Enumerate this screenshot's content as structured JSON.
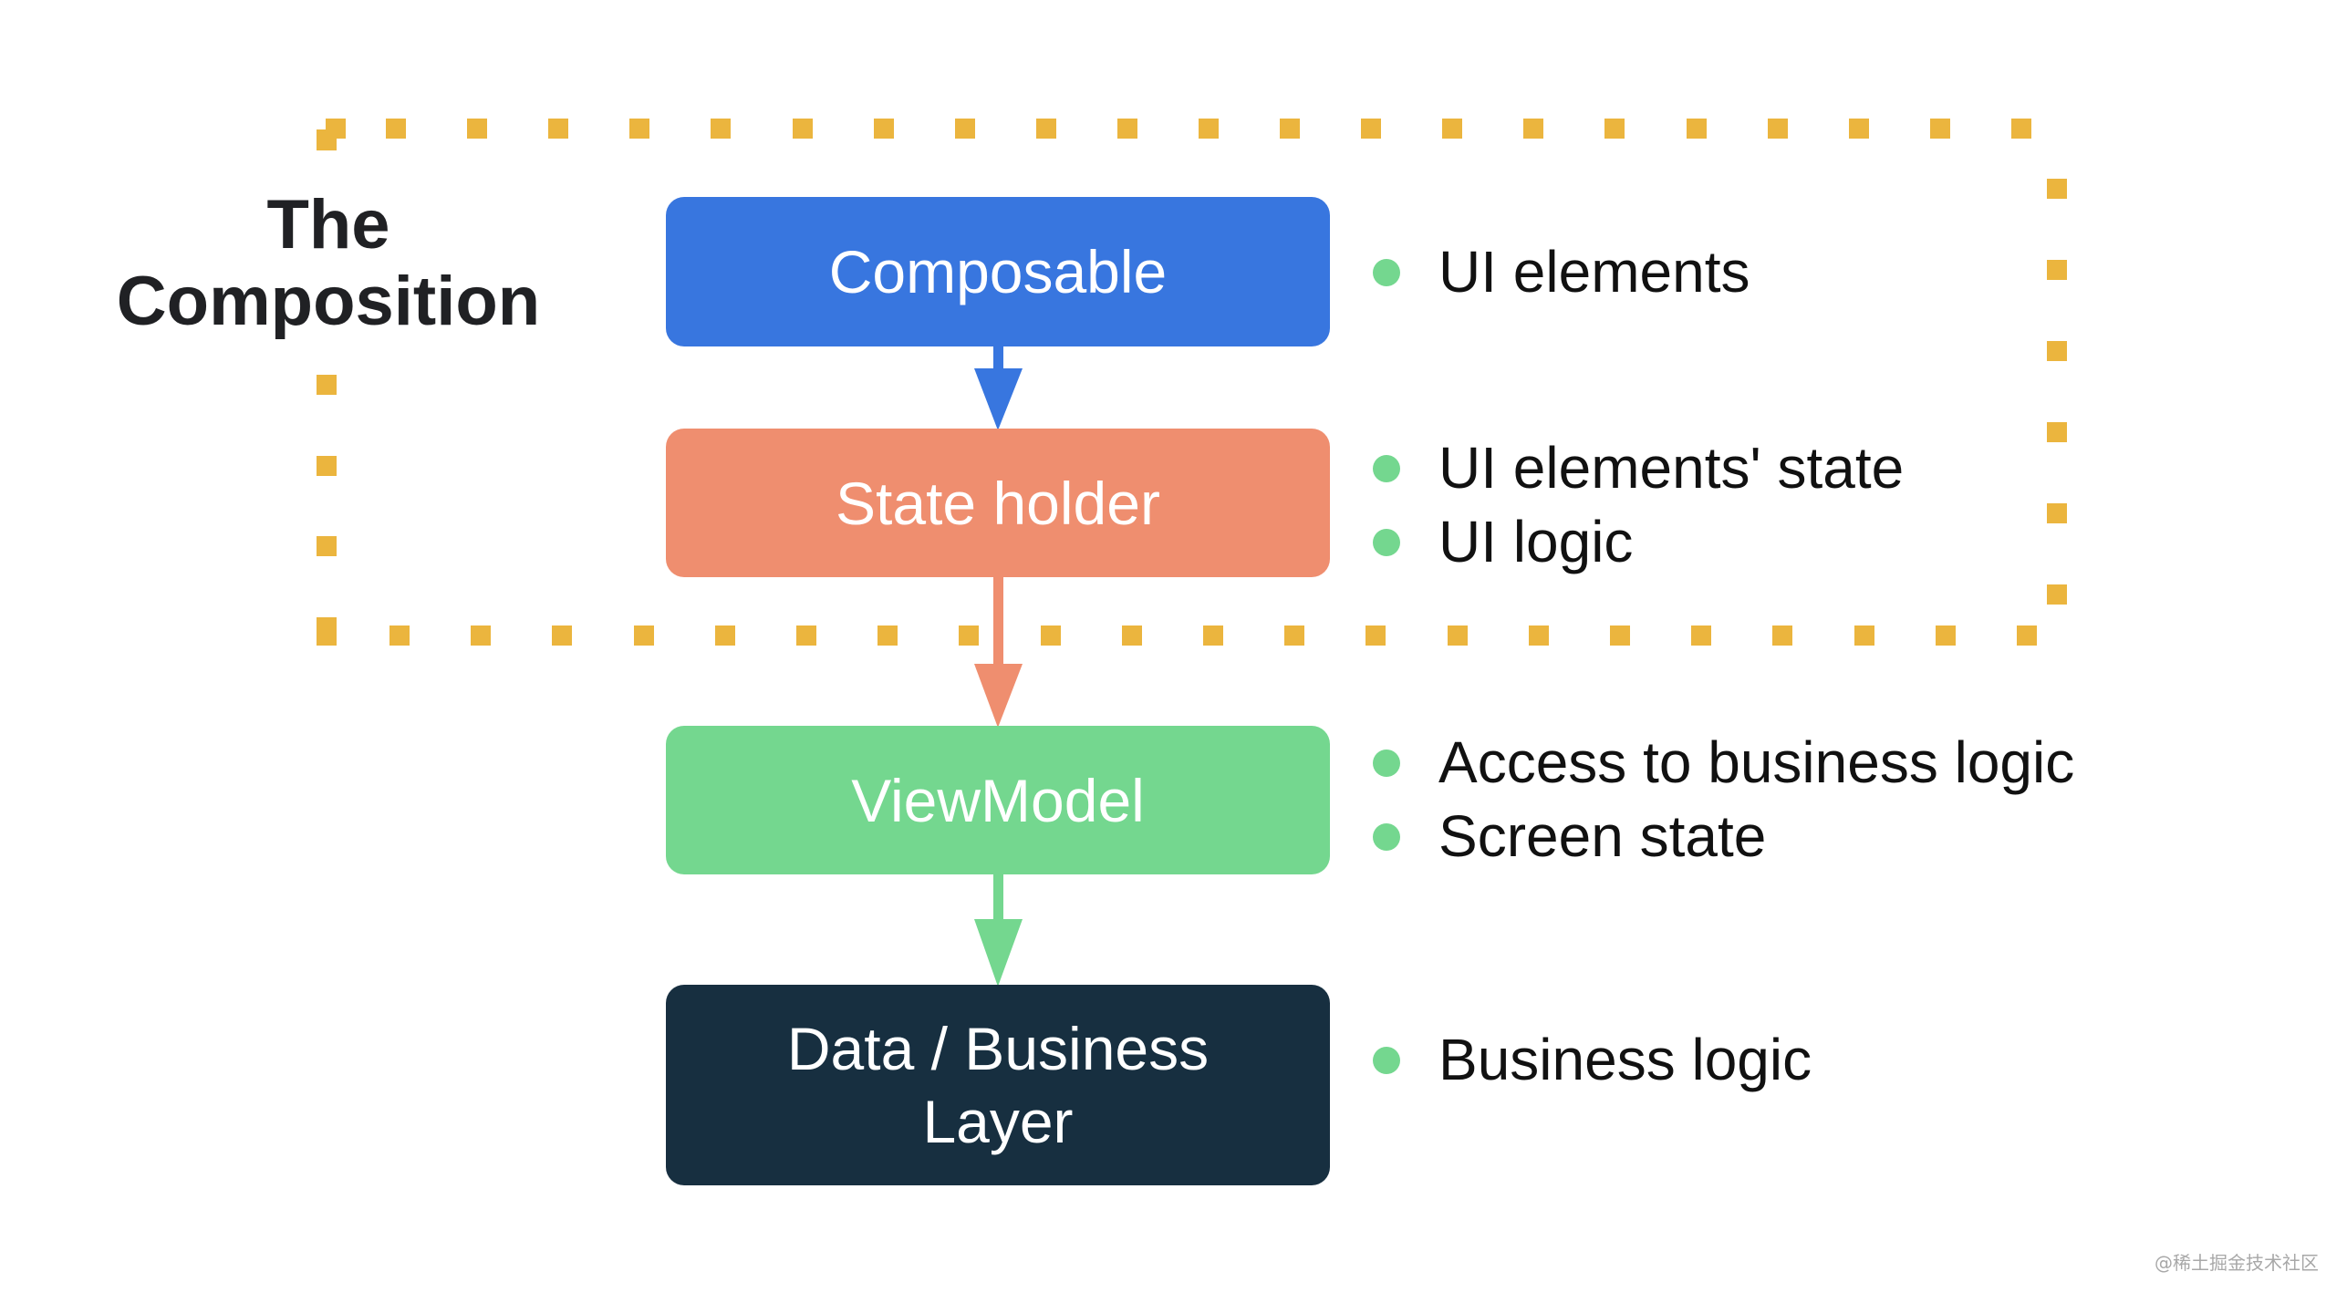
{
  "diagram": {
    "composition_label": [
      "The",
      "Composition"
    ],
    "colors": {
      "composable": "#3876DF",
      "state_holder": "#EF8E6F",
      "viewmodel": "#74D78F",
      "data_layer": "#172F40",
      "dashed_border": "#EBB53E",
      "bullet": "#74D78F",
      "box_text": "#FFFFFF"
    },
    "layers": [
      {
        "id": "composable",
        "label_lines": [
          "Composable"
        ],
        "bullets": [
          "UI elements"
        ]
      },
      {
        "id": "state-holder",
        "label_lines": [
          "State holder"
        ],
        "bullets": [
          "UI elements' state",
          "UI logic"
        ]
      },
      {
        "id": "viewmodel",
        "label_lines": [
          "ViewModel"
        ],
        "bullets": [
          "Access to business logic",
          "Screen state"
        ]
      },
      {
        "id": "data-business-layer",
        "label_lines": [
          "Data / Business",
          "Layer"
        ],
        "bullets": [
          "Business logic"
        ]
      }
    ],
    "arrows": [
      {
        "from": "composable",
        "to": "state-holder"
      },
      {
        "from": "state-holder",
        "to": "viewmodel"
      },
      {
        "from": "viewmodel",
        "to": "data-business-layer"
      }
    ],
    "grouping": {
      "label": "The Composition",
      "contains": [
        "composable",
        "state-holder"
      ],
      "style": "dotted"
    }
  },
  "watermark": "@稀土掘金技术社区"
}
